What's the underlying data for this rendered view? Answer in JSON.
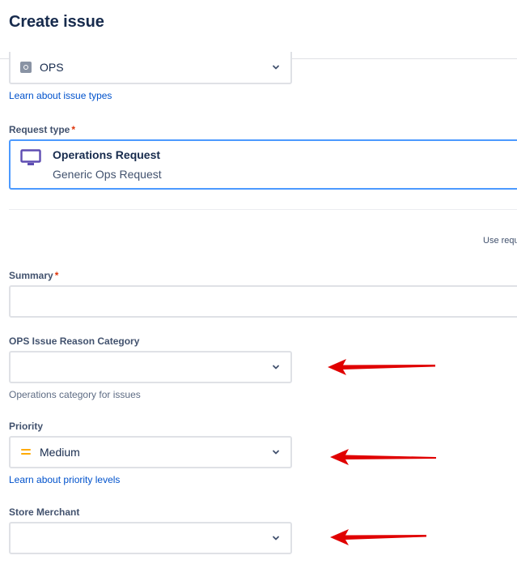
{
  "header": {
    "title": "Create issue"
  },
  "project": {
    "value": "OPS"
  },
  "issue_types_link": "Learn about issue types",
  "request_type": {
    "label": "Request type",
    "required_mark": "*",
    "title": "Operations Request",
    "subtitle": "Generic Ops Request"
  },
  "use_request_text": "Use requ",
  "summary": {
    "label": "Summary",
    "required_mark": "*",
    "value": ""
  },
  "ops_reason": {
    "label": "OPS Issue Reason Category",
    "value": "",
    "help": "Operations category for issues"
  },
  "priority": {
    "label": "Priority",
    "value": "Medium",
    "link": "Learn about priority levels"
  },
  "store_merchant": {
    "label": "Store Merchant",
    "value": ""
  },
  "colors": {
    "link": "#0052CC",
    "required": "#DE350B",
    "focus_border": "#4C9AFF",
    "priority_medium": "#FFAB00",
    "annotation_arrow": "#E00000",
    "request_icon": "#5E4DB2"
  }
}
